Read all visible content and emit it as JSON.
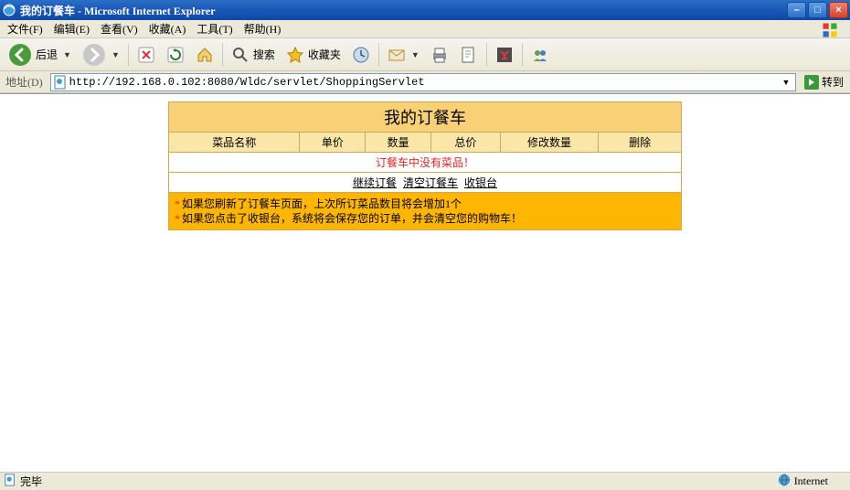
{
  "window": {
    "title": "我的订餐车 - Microsoft Internet Explorer"
  },
  "menu": {
    "file": "文件(F)",
    "edit": "编辑(E)",
    "view": "查看(V)",
    "favorites": "收藏(A)",
    "tools": "工具(T)",
    "help": "帮助(H)"
  },
  "toolbar": {
    "back": "后退",
    "search": "搜索",
    "favorites": "收藏夹"
  },
  "addressbar": {
    "label": "地址(D)",
    "value": "http://192.168.0.102:8080/Wldc/servlet/ShoppingServlet",
    "go": "转到"
  },
  "cart": {
    "title": "我的订餐车",
    "headers": [
      "菜品名称",
      "单价",
      "数量",
      "总价",
      "修改数量",
      "删除"
    ],
    "empty_msg": "订餐车中没有菜品！",
    "links": {
      "continue": "继续订餐",
      "clear": "清空订餐车",
      "checkout": "收银台"
    },
    "tips": [
      "如果您刷新了订餐车页面，上次所订菜品数目将会增加1个",
      "如果您点击了收银台，系统将会保存您的订单，并会清空您的购物车！"
    ]
  },
  "statusbar": {
    "done": "完毕",
    "zone": "Internet"
  }
}
